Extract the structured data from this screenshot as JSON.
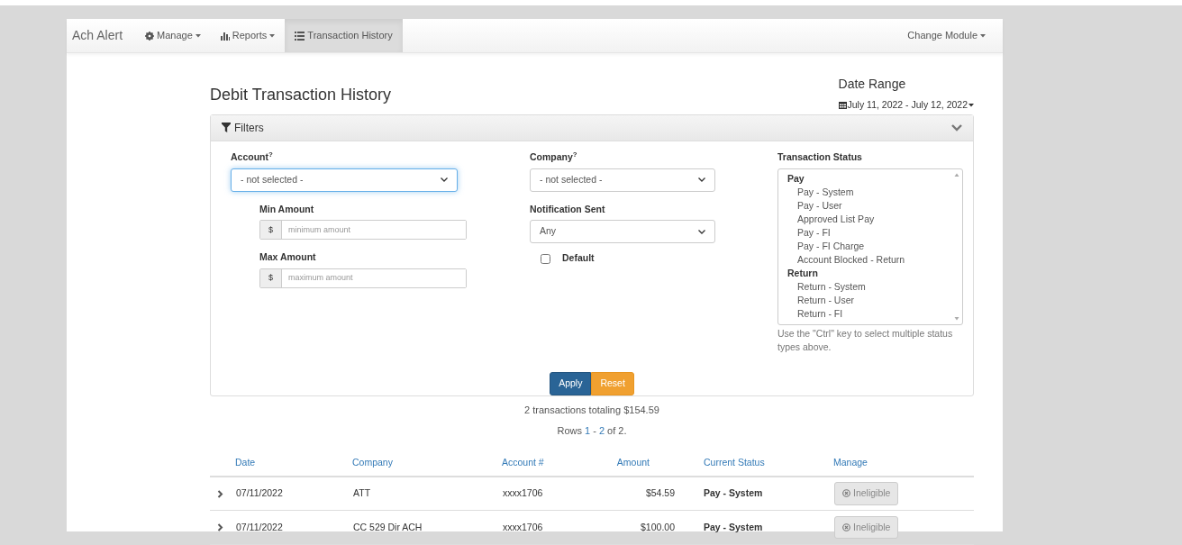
{
  "navbar": {
    "brand": "Ach Alert",
    "items": [
      {
        "label": "Manage",
        "dropdown": true,
        "selected": false
      },
      {
        "label": "Reports",
        "dropdown": true,
        "selected": false
      },
      {
        "label": "Transaction History",
        "dropdown": false,
        "selected": true
      }
    ],
    "right": {
      "label": "Change Module",
      "dropdown": true
    }
  },
  "page_title": "Debit Transaction History",
  "date_range": {
    "label": "Date Range",
    "value": "July 11, 2022 - July 12, 2022"
  },
  "filters": {
    "title": "Filters",
    "expanded": true,
    "account": {
      "label": "Account$^{?}$",
      "value": "- not selected -",
      "focused": true
    },
    "min_amount": {
      "label": "Min Amount",
      "prefix": "$",
      "placeholder": "minimum amount"
    },
    "max_amount": {
      "label": "Max Amount",
      "prefix": "$",
      "placeholder": "maximum amount"
    },
    "company": {
      "label": "Company$^{?}$",
      "value": "- not selected -",
      "focused": false
    },
    "notification_sent": {
      "label": "Notification Sent",
      "value": "Any",
      "focused": false
    },
    "default": {
      "label": "Default",
      "checked": false
    },
    "transaction_status": {
      "label": "Transaction Status",
      "groups": [
        {
          "label": "Pay",
          "options": [
            {
              "label": "Pay - System",
              "selected": false
            },
            {
              "label": "Pay - User",
              "selected": false
            },
            {
              "label": "Approved List Pay",
              "selected": false
            },
            {
              "label": "Pay - FI",
              "selected": false
            },
            {
              "label": "Pay - FI Charge",
              "selected": false
            },
            {
              "label": "Account Blocked - Return",
              "selected": false
            }
          ]
        },
        {
          "label": "Return",
          "options": [
            {
              "label": "Return - System",
              "selected": false
            },
            {
              "label": "Return - User",
              "selected": false
            },
            {
              "label": "Return - FI",
              "selected": false
            }
          ]
        }
      ],
      "help": "Use the \"Ctrl\" key to select multiple status types above."
    },
    "buttons": [
      {
        "label": "Apply",
        "kind": "primary"
      },
      {
        "label": "Reset",
        "kind": "warning"
      }
    ]
  },
  "summary": "2 transactions totaling $154.59",
  "rows_info": {
    "prefix": "Rows",
    "first": "1",
    "separator": "-",
    "last": "2",
    "suffix": "of 2."
  },
  "table": {
    "columns": [
      "Date",
      "Company",
      "Account #",
      "Amount",
      "Current Status",
      "Manage"
    ],
    "rows": [
      {
        "expanded": false,
        "date": "07/11/2022",
        "company": "ATT",
        "account": "xxxx1706",
        "amount": "$54.59",
        "status": "Pay - System",
        "action": {
          "label": "Ineligible",
          "disabled": true
        }
      },
      {
        "expanded": false,
        "date": "07/11/2022",
        "company": "CC 529 Dir ACH",
        "account": "xxxx1706",
        "amount": "$100.00",
        "status": "Pay - System",
        "action": {
          "label": "Ineligible",
          "disabled": true
        }
      }
    ]
  }
}
